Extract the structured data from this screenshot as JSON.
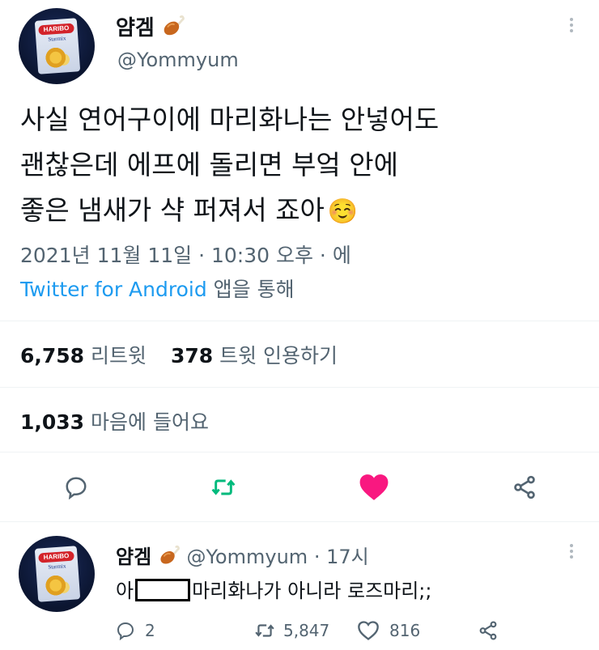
{
  "main_tweet": {
    "display_name": "얌겜",
    "handle": "@Yommyum",
    "avatar_pack_label": "HARIBO",
    "avatar_pack_sub": "Starmix",
    "text_line1": "사실 연어구이에 마리화나는 안넣어도",
    "text_line2": "괜찮은데 에프에 돌리면 부엌 안에",
    "text_line3": "좋은 냄새가 샥 퍼져서 죠아",
    "emoji": "☺️",
    "timestamp": "2021년 11월 11일 · 10:30 오후 · 에",
    "source_app": "Twitter for Android",
    "source_suffix": "앱을 통해",
    "retweets_count": "6,758",
    "retweets_label": "리트윗",
    "quotes_count": "378",
    "quotes_label": "트윗 인용하기",
    "likes_count": "1,033",
    "likes_label": "마음에 들어요"
  },
  "reply_tweet": {
    "display_name": "얌겜",
    "handle": "@Yommyum",
    "time": "· 17시",
    "text_prefix": "아",
    "text_suffix": "마리화나가 아니라 로즈마리;;",
    "reply_count": "2",
    "retweet_count": "5,847",
    "like_count": "816",
    "avatar_pack_label": "HARIBO",
    "avatar_pack_sub": "Starmix"
  },
  "colors": {
    "accent": "#1d9bf0",
    "retweet_green": "#00ba7c",
    "like_pink": "#f91880",
    "muted": "#536471"
  },
  "icons": [
    "more-icon",
    "drumstick-emoji",
    "reply-icon",
    "retweet-icon",
    "heart-icon",
    "share-icon"
  ]
}
